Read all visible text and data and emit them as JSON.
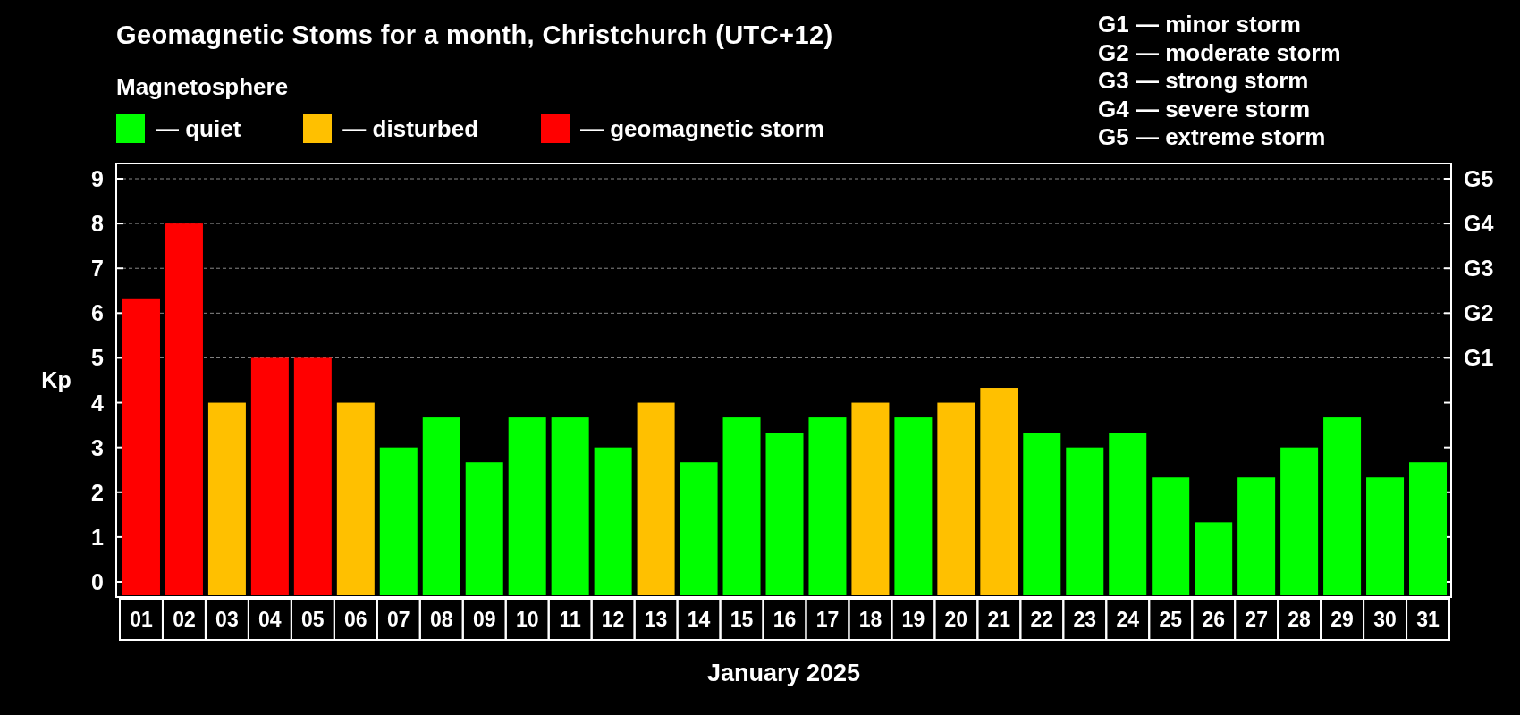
{
  "title": "Geomagnetic Stoms for a month, Christchurch (UTC+12)",
  "legend": {
    "title": "Magnetosphere",
    "dash": "—"
  },
  "scale": [
    "G1 — minor storm",
    "G2 — moderate storm",
    "G3 — strong storm",
    "G4 — severe storm",
    "G5 — extreme storm"
  ],
  "chart_data": {
    "type": "bar",
    "xlabel": "January 2025",
    "ylabel": "Kp",
    "categories": [
      "01",
      "02",
      "03",
      "04",
      "05",
      "06",
      "07",
      "08",
      "09",
      "10",
      "11",
      "12",
      "13",
      "14",
      "15",
      "16",
      "17",
      "18",
      "19",
      "20",
      "21",
      "22",
      "23",
      "24",
      "25",
      "26",
      "27",
      "28",
      "29",
      "30",
      "31"
    ],
    "grid": true,
    "ylim": [
      0,
      9
    ],
    "yticks": [
      0,
      1,
      2,
      3,
      4,
      5,
      6,
      7,
      8,
      9
    ],
    "series": [
      {
        "name": "quiet",
        "color": "#00ff00",
        "values": [
          null,
          null,
          null,
          null,
          null,
          null,
          3,
          3.67,
          2.67,
          3.67,
          3.67,
          3,
          null,
          2.67,
          3.67,
          3.33,
          3.67,
          null,
          3.67,
          null,
          null,
          3.33,
          3,
          3.33,
          2.33,
          1.33,
          2.33,
          3,
          3.67,
          2.33,
          2.67
        ]
      },
      {
        "name": "disturbed",
        "color": "#ffc000",
        "values": [
          null,
          null,
          4,
          null,
          null,
          4,
          null,
          null,
          null,
          null,
          null,
          null,
          4,
          null,
          null,
          null,
          null,
          4,
          null,
          4,
          4.33,
          null,
          null,
          null,
          null,
          null,
          null,
          null,
          null,
          null,
          null
        ]
      },
      {
        "name": "geomagnetic storm",
        "color": "#ff0000",
        "values": [
          6.33,
          8,
          null,
          5,
          5,
          null,
          null,
          null,
          null,
          null,
          null,
          null,
          null,
          null,
          null,
          null,
          null,
          null,
          null,
          null,
          null,
          null,
          null,
          null,
          null,
          null,
          null,
          null,
          null,
          null,
          null
        ]
      }
    ],
    "annotations": [
      "G1",
      "G2",
      "G3",
      "G4",
      "G5"
    ]
  }
}
